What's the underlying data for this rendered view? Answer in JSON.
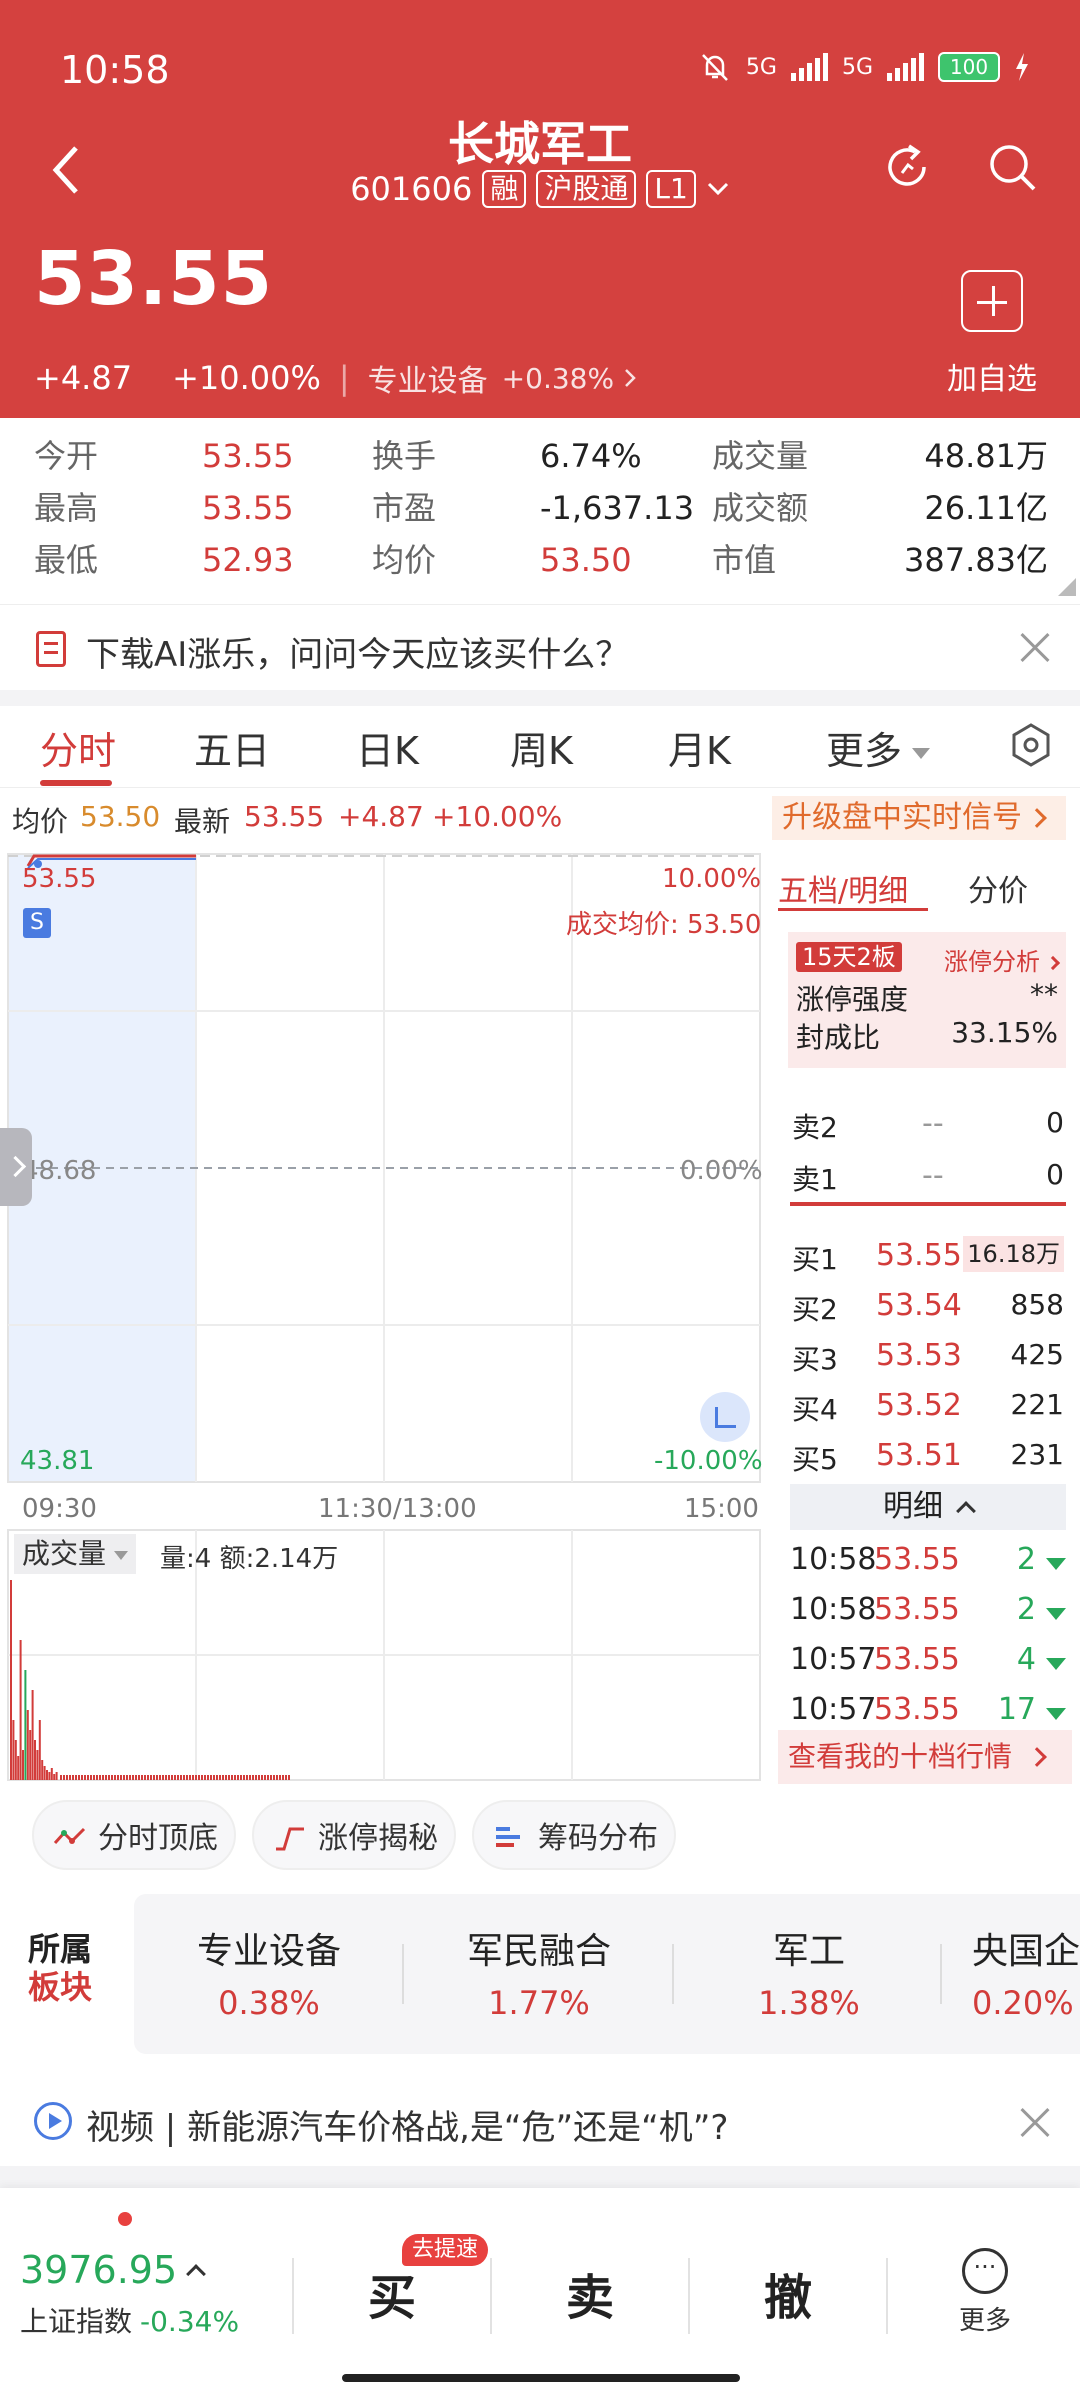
{
  "status_bar": {
    "time": "10:58",
    "net1": "5G",
    "net2": "5G",
    "battery": "100"
  },
  "header": {
    "stock_name": "长城军工",
    "code": "601606",
    "tags": [
      "融",
      "沪股通",
      "L1"
    ],
    "price": "53.55",
    "change": "+4.87",
    "change_pct": "+10.00%",
    "sector": "专业设备",
    "sector_change": "+0.38%",
    "add_fav_label": "加自选",
    "colors": {
      "header_bg": "#d4413f",
      "up": "#d23c3a",
      "down": "#27a85a"
    }
  },
  "quote": {
    "open_label": "今开",
    "open": "53.55",
    "high_label": "最高",
    "high": "53.55",
    "low_label": "最低",
    "low": "52.93",
    "turnover_label": "换手",
    "turnover": "6.74%",
    "pe_label": "市盈",
    "pe": "-1,637.13",
    "avg_label": "均价",
    "avg": "53.50",
    "volume_label": "成交量",
    "volume": "48.81万",
    "amount_label": "成交额",
    "amount": "26.11亿",
    "mcap_label": "市值",
    "mcap": "387.83亿"
  },
  "ai_banner": {
    "text": "下载AI涨乐，问问今天应该买什么？"
  },
  "tabs": {
    "items": [
      "分时",
      "五日",
      "日K",
      "周K",
      "月K",
      "更多"
    ],
    "active": 0
  },
  "info_row": {
    "avg_label": "均价",
    "avg": "53.50",
    "latest_label": "最新",
    "latest": "53.55",
    "chg": "+4.87",
    "pct": "+10.00%",
    "upgrade_label": "升级盘中实时信号"
  },
  "chart": {
    "y_top": "53.55",
    "y_mid": "48.68",
    "y_bot": "43.81",
    "pct_top": "10.00%",
    "pct_mid": "0.00%",
    "pct_bot": "-10.00%",
    "avg_text": "成交均价: 53.50",
    "s_badge": "S",
    "x_labels": [
      "09:30",
      "11:30/13:00",
      "15:00"
    ],
    "price_min": 43.81,
    "price_max": 53.55,
    "price_prev_close": 48.68,
    "volume_label": "成交量",
    "volume_info": "量:4 额:2.14万",
    "elapsed_fraction": 0.375
  },
  "right_panel": {
    "tab_depth": "五档/明细",
    "tab_price": "分价",
    "limit_tag": "15天2板",
    "limit_analysis": "涨停分析",
    "limit_strength_label": "涨停强度",
    "limit_strength": "**",
    "seal_ratio_label": "封成比",
    "seal_ratio": "33.15%",
    "asks": [
      {
        "label": "卖2",
        "price": "--",
        "vol": "0"
      },
      {
        "label": "卖1",
        "price": "--",
        "vol": "0"
      }
    ],
    "bids": [
      {
        "label": "买1",
        "price": "53.55",
        "vol": "16.18万"
      },
      {
        "label": "买2",
        "price": "53.54",
        "vol": "858"
      },
      {
        "label": "买3",
        "price": "53.53",
        "vol": "425"
      },
      {
        "label": "买4",
        "price": "53.52",
        "vol": "221"
      },
      {
        "label": "买5",
        "price": "53.51",
        "vol": "231"
      }
    ],
    "detail_header": "明细",
    "ticks": [
      {
        "time": "10:58",
        "price": "53.55",
        "vol": "2"
      },
      {
        "time": "10:58",
        "price": "53.55",
        "vol": "2"
      },
      {
        "time": "10:57",
        "price": "53.55",
        "vol": "4"
      },
      {
        "time": "10:57",
        "price": "53.55",
        "vol": "17"
      }
    ],
    "my_ten_label": "查看我的十档行情"
  },
  "tools": [
    "分时顶底",
    "涨停揭秘",
    "筹码分布"
  ],
  "sectors": {
    "title_line1": "所属",
    "title_line2": "板块",
    "items": [
      {
        "name": "专业设备",
        "change": "0.38%"
      },
      {
        "name": "军民融合",
        "change": "1.77%"
      },
      {
        "name": "军工",
        "change": "1.38%"
      },
      {
        "name": "央国企",
        "change": "0.20%"
      }
    ]
  },
  "video_banner": {
    "text": "视频 | 新能源汽车价格战,是“危”还是“机”?"
  },
  "bottom_bar": {
    "index_value": "3976.95",
    "index_name": "上证指数",
    "index_change": "-0.34%",
    "buy": "买",
    "sell": "卖",
    "cancel": "撤",
    "fast_badge": "去提速",
    "more": "更多"
  }
}
